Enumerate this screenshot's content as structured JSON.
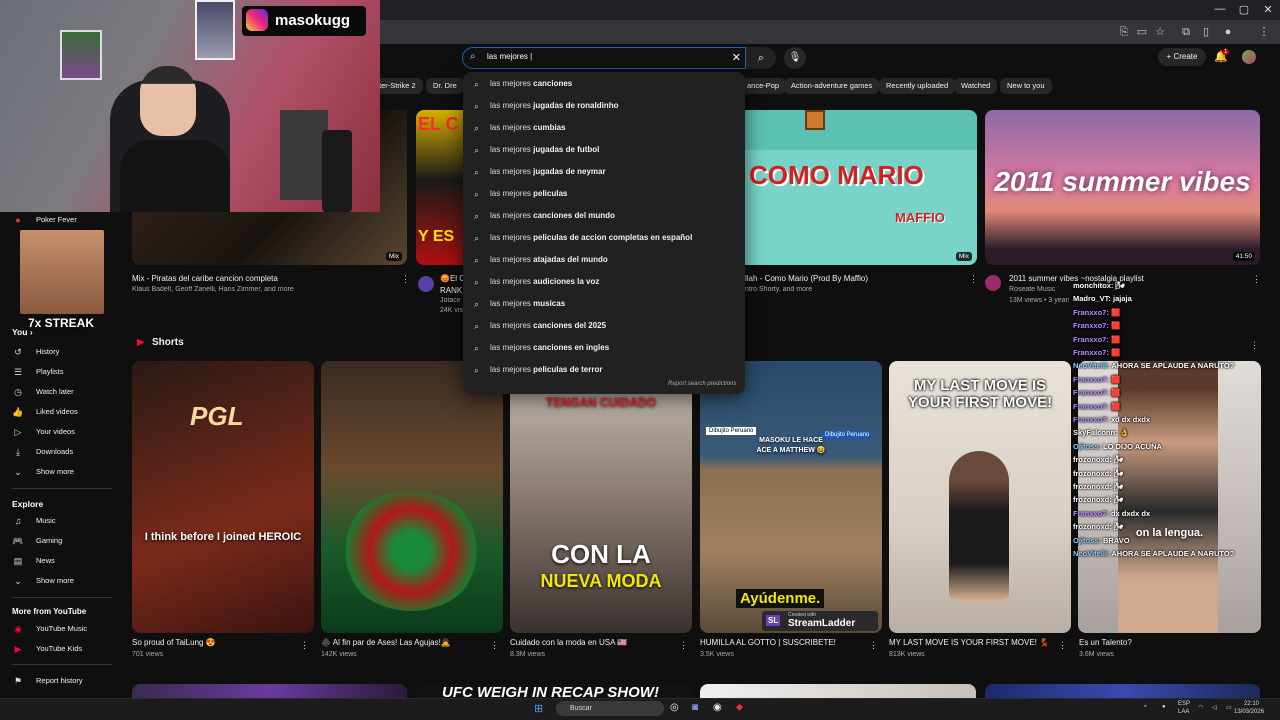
{
  "browser": {
    "window_controls": [
      "—",
      "▢",
      "✕"
    ]
  },
  "streamer": {
    "instagram_handle": "masokugg",
    "streak": "7x STREAK"
  },
  "search": {
    "query": "las mejores |",
    "clear": "✕"
  },
  "header": {
    "create_label": "Create",
    "notifications": "1"
  },
  "chips": [
    "ter-Strike 2",
    "Dr. Dre",
    "ance-Pop",
    "Action-adventure games",
    "Recently uploaded",
    "Watched",
    "New to you"
  ],
  "suggestions": [
    {
      "prefix": "las mejores ",
      "rest": "canciones"
    },
    {
      "prefix": "las mejores ",
      "rest": "jugadas de ronaldinho"
    },
    {
      "prefix": "las mejores ",
      "rest": "cumbias"
    },
    {
      "prefix": "las mejores ",
      "rest": "jugadas de futbol"
    },
    {
      "prefix": "las mejores ",
      "rest": "jugadas de neymar"
    },
    {
      "prefix": "las mejores ",
      "rest": "peliculas"
    },
    {
      "prefix": "las mejores ",
      "rest": "canciones del mundo"
    },
    {
      "prefix": "las mejores ",
      "rest": "peliculas de accion completas en español"
    },
    {
      "prefix": "las mejores ",
      "rest": "atajadas del mundo"
    },
    {
      "prefix": "las mejores ",
      "rest": "audiciones la voz"
    },
    {
      "prefix": "las mejores ",
      "rest": "musicas"
    },
    {
      "prefix": "las mejores ",
      "rest": "canciones del 2025"
    },
    {
      "prefix": "las mejores ",
      "rest": "canciones en ingles"
    },
    {
      "prefix": "las mejores ",
      "rest": "peliculas de terror"
    }
  ],
  "report_predictions": "Report search predictions",
  "sidebar": {
    "subscription_top": "Poker Fever",
    "you_label": "You",
    "you_items": [
      "History",
      "Playlists",
      "Watch later",
      "Liked videos",
      "Your videos",
      "Downloads",
      "Show more"
    ],
    "explore_label": "Explore",
    "explore_items": [
      "Music",
      "Gaming",
      "News",
      "Show more"
    ],
    "more_label": "More from YouTube",
    "more_items": [
      "YouTube Music",
      "YouTube Kids"
    ],
    "report_history": "Report history"
  },
  "videos": [
    {
      "title": "Mix - Piratas del  caribe  cancion completa",
      "meta": "Klaus Badelt, Geoff Zanelli, Hans Zimmer, and more",
      "badge": "Mix"
    },
    {
      "title": "😡El C",
      "title2": "RANK",
      "meta": "Jotace",
      "meta2": "24K vis"
    },
    {
      "title": "llah - Como Mario (Prod By Maffio)",
      "meta": "ntro Shorty, and more",
      "badge": "Mix",
      "thumb_text": "COMO MARIO",
      "thumb_sub": "MAFFIO"
    },
    {
      "title": "2011 summer vibes ~nostalgia playlist",
      "meta": "Roseate Music",
      "meta2": "13M views • 3 years",
      "duration": "41:50",
      "thumb_text": "2011 summer vibes"
    }
  ],
  "shorts_label": "Shorts",
  "shorts": [
    {
      "title": "So proud of TaiLung 😍",
      "views": "701 views",
      "caption": "I think before I joined HEROIC",
      "logo": "PGL"
    },
    {
      "title": "♠️ Al fin par de Ases! Las Agujas!🙇",
      "views": "142K views"
    },
    {
      "title": "Cuidado con la moda en USA 🇺🇸",
      "views": "8.3M views",
      "top_text": "TENGAN CUIDADO",
      "caption1": "CON LA",
      "caption2": "NUEVA MODA"
    },
    {
      "title": "HUMILLA AL GOTTO | SUSCRIBETE!",
      "views": "3.5K views",
      "tag1": "Dibujito Peruano",
      "tag2": "Dibujito Peruano",
      "text1": "MASOKU LE HACE",
      "text2": "ACE A MATTHEW 😆",
      "caption": "Ayúdenme.",
      "created": "Created with",
      "brand": "StreamLadder",
      "brand_icon": "SL"
    },
    {
      "title": "MY LAST MOVE IS YOUR FIRST MOVE! 💃",
      "views": "813K views",
      "top_text": "MY LAST MOVE IS YOUR FIRST MOVE!"
    },
    {
      "title": "Es un Talento?",
      "views": "3.6M views",
      "caption": "on la lengua."
    }
  ],
  "next_row_text": "UFC WEIGH IN RECAP SHOW!",
  "chat": [
    {
      "user": "monchitox:",
      "msg": "🌬",
      "color": "#ffffff"
    },
    {
      "user": "Madro_VT:",
      "msg": "jajaja",
      "color": "#ffffff"
    },
    {
      "user": "Franxxo7:",
      "msg": "🟥",
      "color": "#b38cff"
    },
    {
      "user": "Franxxo7:",
      "msg": "🟥",
      "color": "#b38cff"
    },
    {
      "user": "Franxxo7:",
      "msg": "🟥",
      "color": "#b38cff"
    },
    {
      "user": "Franxxo7:",
      "msg": "🟥",
      "color": "#b38cff"
    },
    {
      "user": "NeoVitelli:",
      "msg": "AHORA SE APLAUDE A NARUTO?",
      "color": "#8fd0ff"
    },
    {
      "user": "Franxxo7:",
      "msg": "🟥",
      "color": "#b38cff"
    },
    {
      "user": "Franxxo7:",
      "msg": "🟥",
      "color": "#b38cff"
    },
    {
      "user": "Franxxo7:",
      "msg": "🟥",
      "color": "#b38cff"
    },
    {
      "user": "Franxxo7:",
      "msg": "xd dx dxdx",
      "color": "#b38cff"
    },
    {
      "user": "SkyFalconn:",
      "msg": "👌",
      "color": "#ffffff"
    },
    {
      "user": "Ojitoss:",
      "msg": "LO DIJO ACUÑA",
      "color": "#8fd0ff"
    },
    {
      "user": "frozonoxd:",
      "msg": "🌬",
      "color": "#ffffff"
    },
    {
      "user": "frozonoxd:",
      "msg": "🌬",
      "color": "#ffffff"
    },
    {
      "user": "frozonoxd:",
      "msg": "🌬",
      "color": "#ffffff"
    },
    {
      "user": "frozonoxd:",
      "msg": "🌬",
      "color": "#ffffff"
    },
    {
      "user": "Franxxo7:",
      "msg": "dx dxdx dx",
      "color": "#b38cff"
    },
    {
      "user": "frozonoxd:",
      "msg": "🌬",
      "color": "#ffffff"
    },
    {
      "user": "Ojitoss:",
      "msg": "BRAVO",
      "color": "#8fd0ff"
    },
    {
      "user": "NeoVitelli:",
      "msg": "AHORA SE APLAUDE A NARUTO?",
      "color": "#8fd0ff"
    }
  ],
  "taskbar": {
    "search_placeholder": "Buscar",
    "lang1": "ESP",
    "lang2": "LAA",
    "time": "22:10",
    "date": "13/03/2026"
  }
}
